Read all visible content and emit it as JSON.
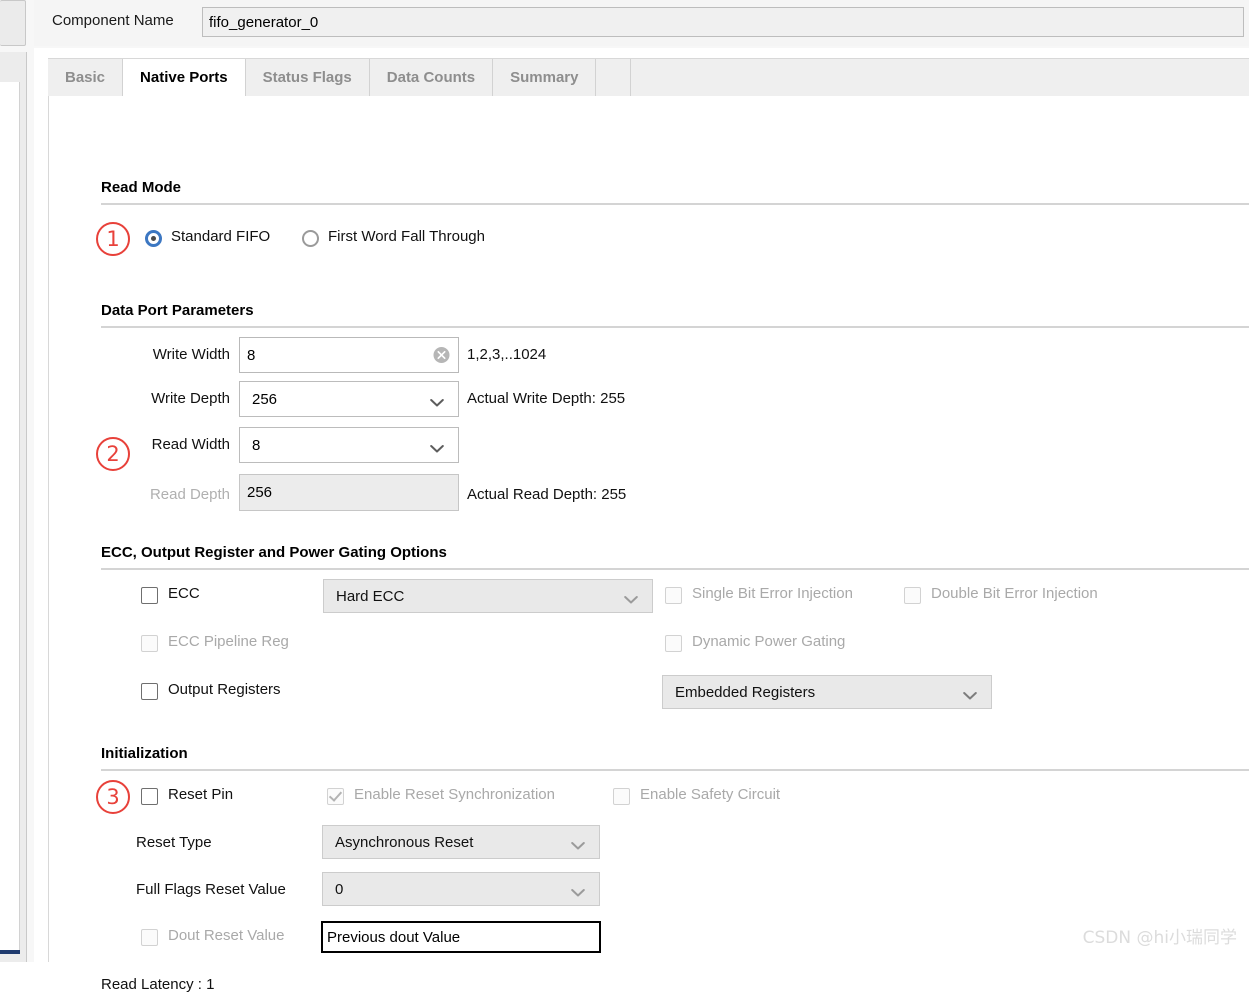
{
  "header": {
    "component_name_label": "Component Name",
    "component_name_value": "fifo_generator_0"
  },
  "tabs": [
    {
      "label": "Basic",
      "active": false
    },
    {
      "label": "Native Ports",
      "active": true
    },
    {
      "label": "Status Flags",
      "active": false
    },
    {
      "label": "Data Counts",
      "active": false
    },
    {
      "label": "Summary",
      "active": false
    }
  ],
  "read_mode": {
    "title": "Read Mode",
    "annotation": "1",
    "options": [
      {
        "label": "Standard FIFO",
        "selected": true
      },
      {
        "label": "First Word Fall Through",
        "selected": false
      }
    ]
  },
  "data_port": {
    "title": "Data Port Parameters",
    "annotation": "2",
    "write_width_label": "Write Width",
    "write_width_value": "8",
    "write_width_hint": "1,2,3,..1024",
    "write_depth_label": "Write Depth",
    "write_depth_value": "256",
    "actual_write_depth": "Actual Write Depth: 255",
    "read_width_label": "Read Width",
    "read_width_value": "8",
    "read_depth_label": "Read Depth",
    "read_depth_value": "256",
    "actual_read_depth": "Actual Read Depth: 255"
  },
  "ecc": {
    "title": "ECC, Output Register and Power Gating Options",
    "ecc_label": "ECC",
    "ecc_mode_value": "Hard ECC",
    "single_bit_label": "Single Bit Error Injection",
    "double_bit_label": "Double Bit Error Injection",
    "ecc_pipeline_label": "ECC Pipeline Reg",
    "dynamic_power_gating_label": "Dynamic Power Gating",
    "output_registers_label": "Output Registers",
    "output_registers_value": "Embedded Registers"
  },
  "initialization": {
    "title": "Initialization",
    "annotation": "3",
    "reset_pin_label": "Reset Pin",
    "enable_reset_sync_label": "Enable Reset Synchronization",
    "enable_safety_circuit_label": "Enable Safety Circuit",
    "reset_type_label": "Reset Type",
    "reset_type_value": "Asynchronous Reset",
    "full_flags_label": "Full Flags Reset Value",
    "full_flags_value": "0",
    "dout_reset_label": "Dout Reset Value",
    "dout_reset_value": "Previous dout Value"
  },
  "footer": {
    "read_latency": "Read Latency : 1"
  },
  "watermark": "CSDN @hi小瑞同学",
  "colors": {
    "accent_blue": "#3c77c2",
    "annotation_red": "#e8413a",
    "panel_gray": "#efefef",
    "disabled_text": "#a9a9a9"
  }
}
